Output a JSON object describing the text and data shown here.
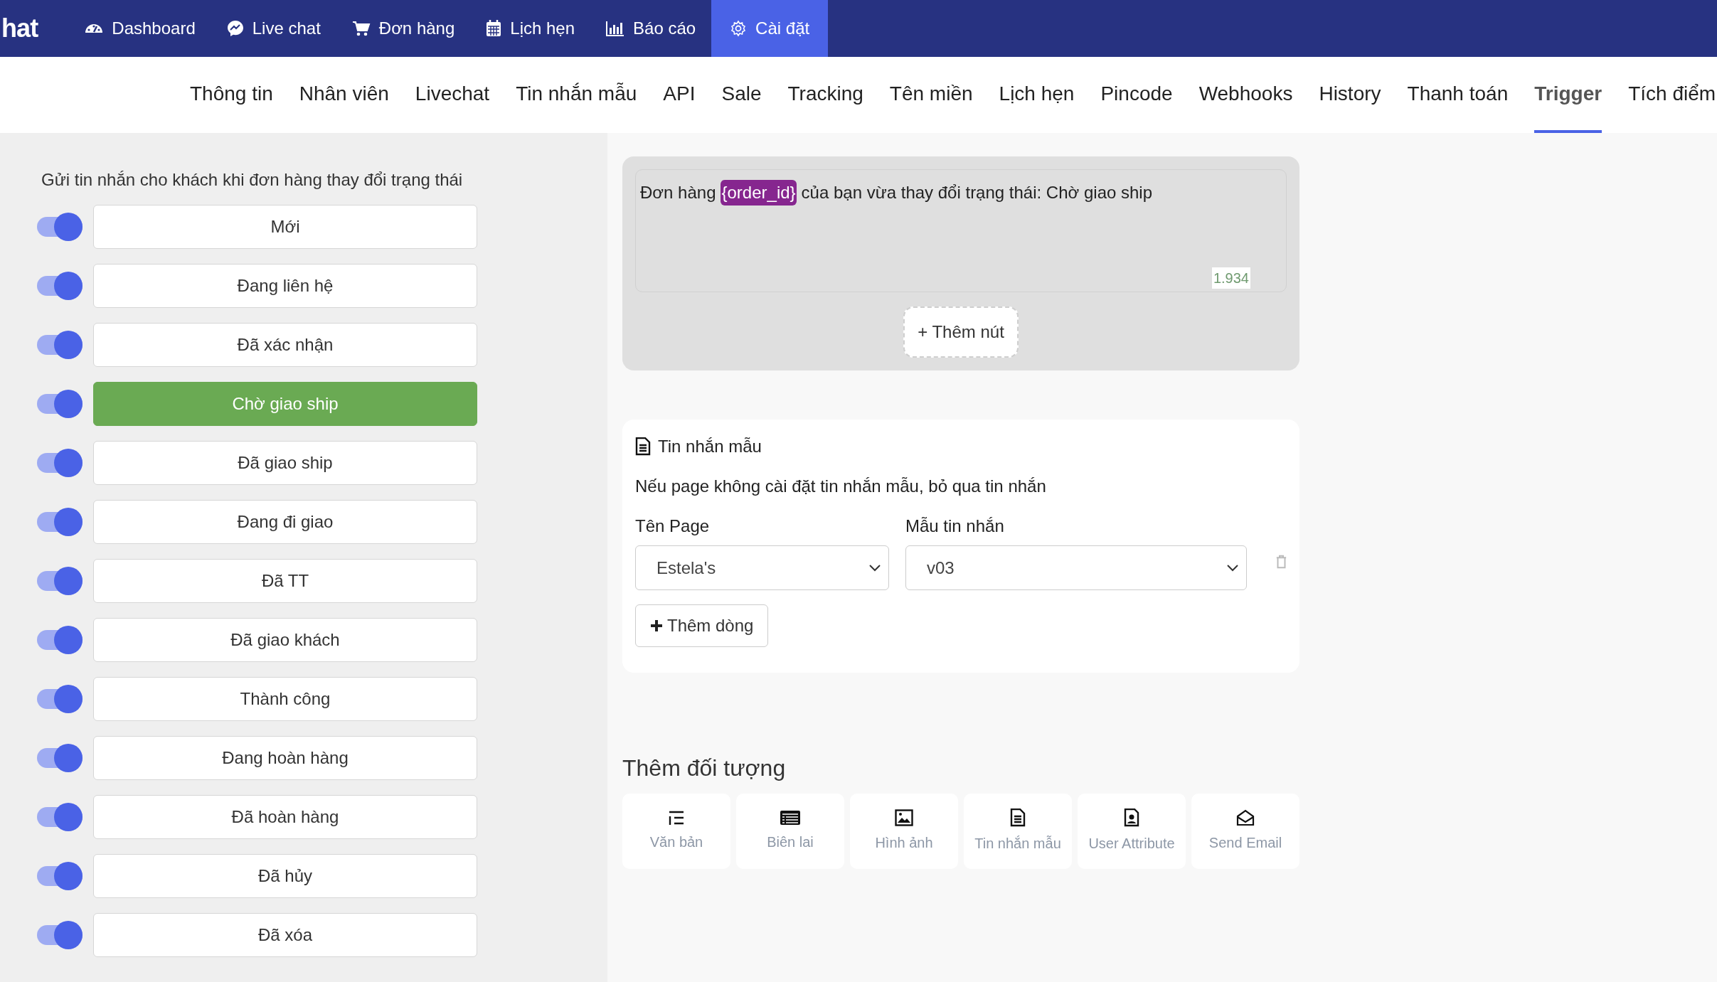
{
  "brand": {
    "text": "hat"
  },
  "nav": [
    {
      "kind": "dashboard",
      "label": "Dashboard",
      "selected": false
    },
    {
      "kind": "chat",
      "label": "Live chat",
      "selected": false
    },
    {
      "kind": "cart",
      "label": "Đơn hàng",
      "selected": false
    },
    {
      "kind": "calendar",
      "label": "Lịch hẹn",
      "selected": false
    },
    {
      "kind": "report",
      "label": "Báo cáo",
      "selected": false
    },
    {
      "kind": "settings",
      "label": "Cài đặt",
      "selected": true
    }
  ],
  "tabs": [
    {
      "label": "Thông tin",
      "selected": false
    },
    {
      "label": "Nhân viên",
      "selected": false
    },
    {
      "label": "Livechat",
      "selected": false
    },
    {
      "label": "Tin nhắn mẫu",
      "selected": false
    },
    {
      "label": "API",
      "selected": false
    },
    {
      "label": "Sale",
      "selected": false
    },
    {
      "label": "Tracking",
      "selected": false
    },
    {
      "label": "Tên miền",
      "selected": false
    },
    {
      "label": "Lịch hẹn",
      "selected": false
    },
    {
      "label": "Pincode",
      "selected": false
    },
    {
      "label": "Webhooks",
      "selected": false
    },
    {
      "label": "History",
      "selected": false
    },
    {
      "label": "Thanh toán",
      "selected": false
    },
    {
      "label": "Trigger",
      "selected": true
    },
    {
      "label": "Tích điểm",
      "selected": false
    }
  ],
  "status_panel": {
    "title": "Gửi tin nhắn cho khách khi đơn hàng thay đổi trạng thái",
    "statuses": [
      {
        "label": "Mới",
        "on": true,
        "selected": false
      },
      {
        "label": "Đang liên hệ",
        "on": true,
        "selected": false
      },
      {
        "label": "Đã xác nhận",
        "on": true,
        "selected": false
      },
      {
        "label": "Chờ giao ship",
        "on": true,
        "selected": true
      },
      {
        "label": "Đã giao ship",
        "on": true,
        "selected": false
      },
      {
        "label": "Đang đi giao",
        "on": true,
        "selected": false
      },
      {
        "label": "Đã TT",
        "on": true,
        "selected": false
      },
      {
        "label": "Đã giao khách",
        "on": true,
        "selected": false
      },
      {
        "label": "Thành công",
        "on": true,
        "selected": false
      },
      {
        "label": "Đang hoàn hàng",
        "on": true,
        "selected": false
      },
      {
        "label": "Đã hoàn hàng",
        "on": true,
        "selected": false
      },
      {
        "label": "Đã hủy",
        "on": true,
        "selected": false
      },
      {
        "label": "Đã xóa",
        "on": true,
        "selected": false
      }
    ]
  },
  "message_card": {
    "parts": [
      {
        "kind": "text",
        "text": "Đơn hàng"
      },
      {
        "kind": "variable",
        "text": "{order_id}"
      },
      {
        "kind": "text",
        "text": "của bạn vừa thay đổi trạng thái: Chờ giao ship"
      }
    ],
    "counter": "1.934",
    "add_button": "+ Thêm nút"
  },
  "template_card": {
    "title": "Tin nhắn mẫu",
    "note": "Nếu page không cài đặt tin nhắn mẫu, bỏ qua tin nhắn",
    "page_label": "Tên Page",
    "page_value": "Estela's",
    "template_label": "Mẫu tin nhắn",
    "template_value": "v03",
    "add_row": "Thêm dòng"
  },
  "add_objects": {
    "title": "Thêm đối tượng",
    "items": [
      {
        "kind": "text",
        "label": "Văn bản"
      },
      {
        "kind": "receipt",
        "label": "Biên lai"
      },
      {
        "kind": "image",
        "label": "Hình ảnh"
      },
      {
        "kind": "template",
        "label": "Tin nhắn mẫu"
      },
      {
        "kind": "user",
        "label": "User Attribute"
      },
      {
        "kind": "email",
        "label": "Send Email"
      }
    ]
  }
}
